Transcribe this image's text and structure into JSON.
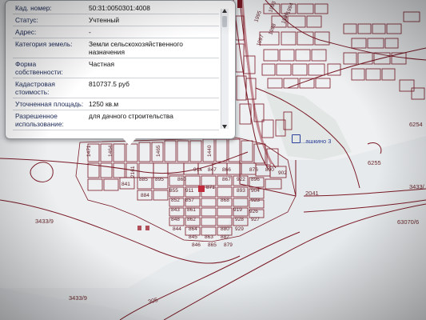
{
  "popup": {
    "rows": [
      {
        "key": "Кад. номер:",
        "value": "50:31:0050301:4008"
      },
      {
        "key": "Статус:",
        "value": "Учтенный"
      },
      {
        "key": "Адрес:",
        "value": "-"
      },
      {
        "key": "Категория земель:",
        "value": "Земли сельскохозяйственного назначения"
      },
      {
        "key": "Форма собственности:",
        "value": "Частная"
      },
      {
        "key": "Кадастровая стоимость:",
        "value": "810737.5 руб"
      },
      {
        "key": "Уточненная площадь:",
        "value": "1250 кв.м"
      },
      {
        "key": "Разрешенное использование:",
        "value": "для дачного строительства"
      }
    ]
  },
  "map": {
    "place_label": "...ашкино 3",
    "labels": {
      "l3433_9_a": "3433/9",
      "l3433_9_b": "3433/9",
      "l6254": "6254",
      "l6255": "6255",
      "l2041": "2041",
      "l63070_6": "63070/6",
      "l3433_r": "3433/",
      "l305": "305",
      "l1997": "1997",
      "l1998": "1998",
      "l1995": "1995",
      "l1993": "1993",
      "l1996": "1996",
      "l1994": "1994"
    },
    "parcels": {
      "p914": "914",
      "p847": "847",
      "p866": "866",
      "p876": "876",
      "p890": "890",
      "p895": "895",
      "p860": "860",
      "p867": "867",
      "p922": "922",
      "p896": "896",
      "p902": "902",
      "p884": "884",
      "p855": "855",
      "p911": "911",
      "p871": "871",
      "p893": "893",
      "p904": "904",
      "p852": "852",
      "p857": "857",
      "p868": "868",
      "p923": "923",
      "p843": "843",
      "p861": "861",
      "p919": "919",
      "p926": "926",
      "p848": "848",
      "p862": "862",
      "p928": "928",
      "p927": "927",
      "p844": "844",
      "p864": "864",
      "p880": "880",
      "p929": "929",
      "p845": "845",
      "p863": "863",
      "p882": "882",
      "p846": "846",
      "p865": "865",
      "p879": "879",
      "p2161": "2161",
      "p841": "841",
      "p885": "885",
      "p1471": "1471",
      "p1464": "1464",
      "p1465": "1465",
      "p1440": "1440"
    }
  }
}
